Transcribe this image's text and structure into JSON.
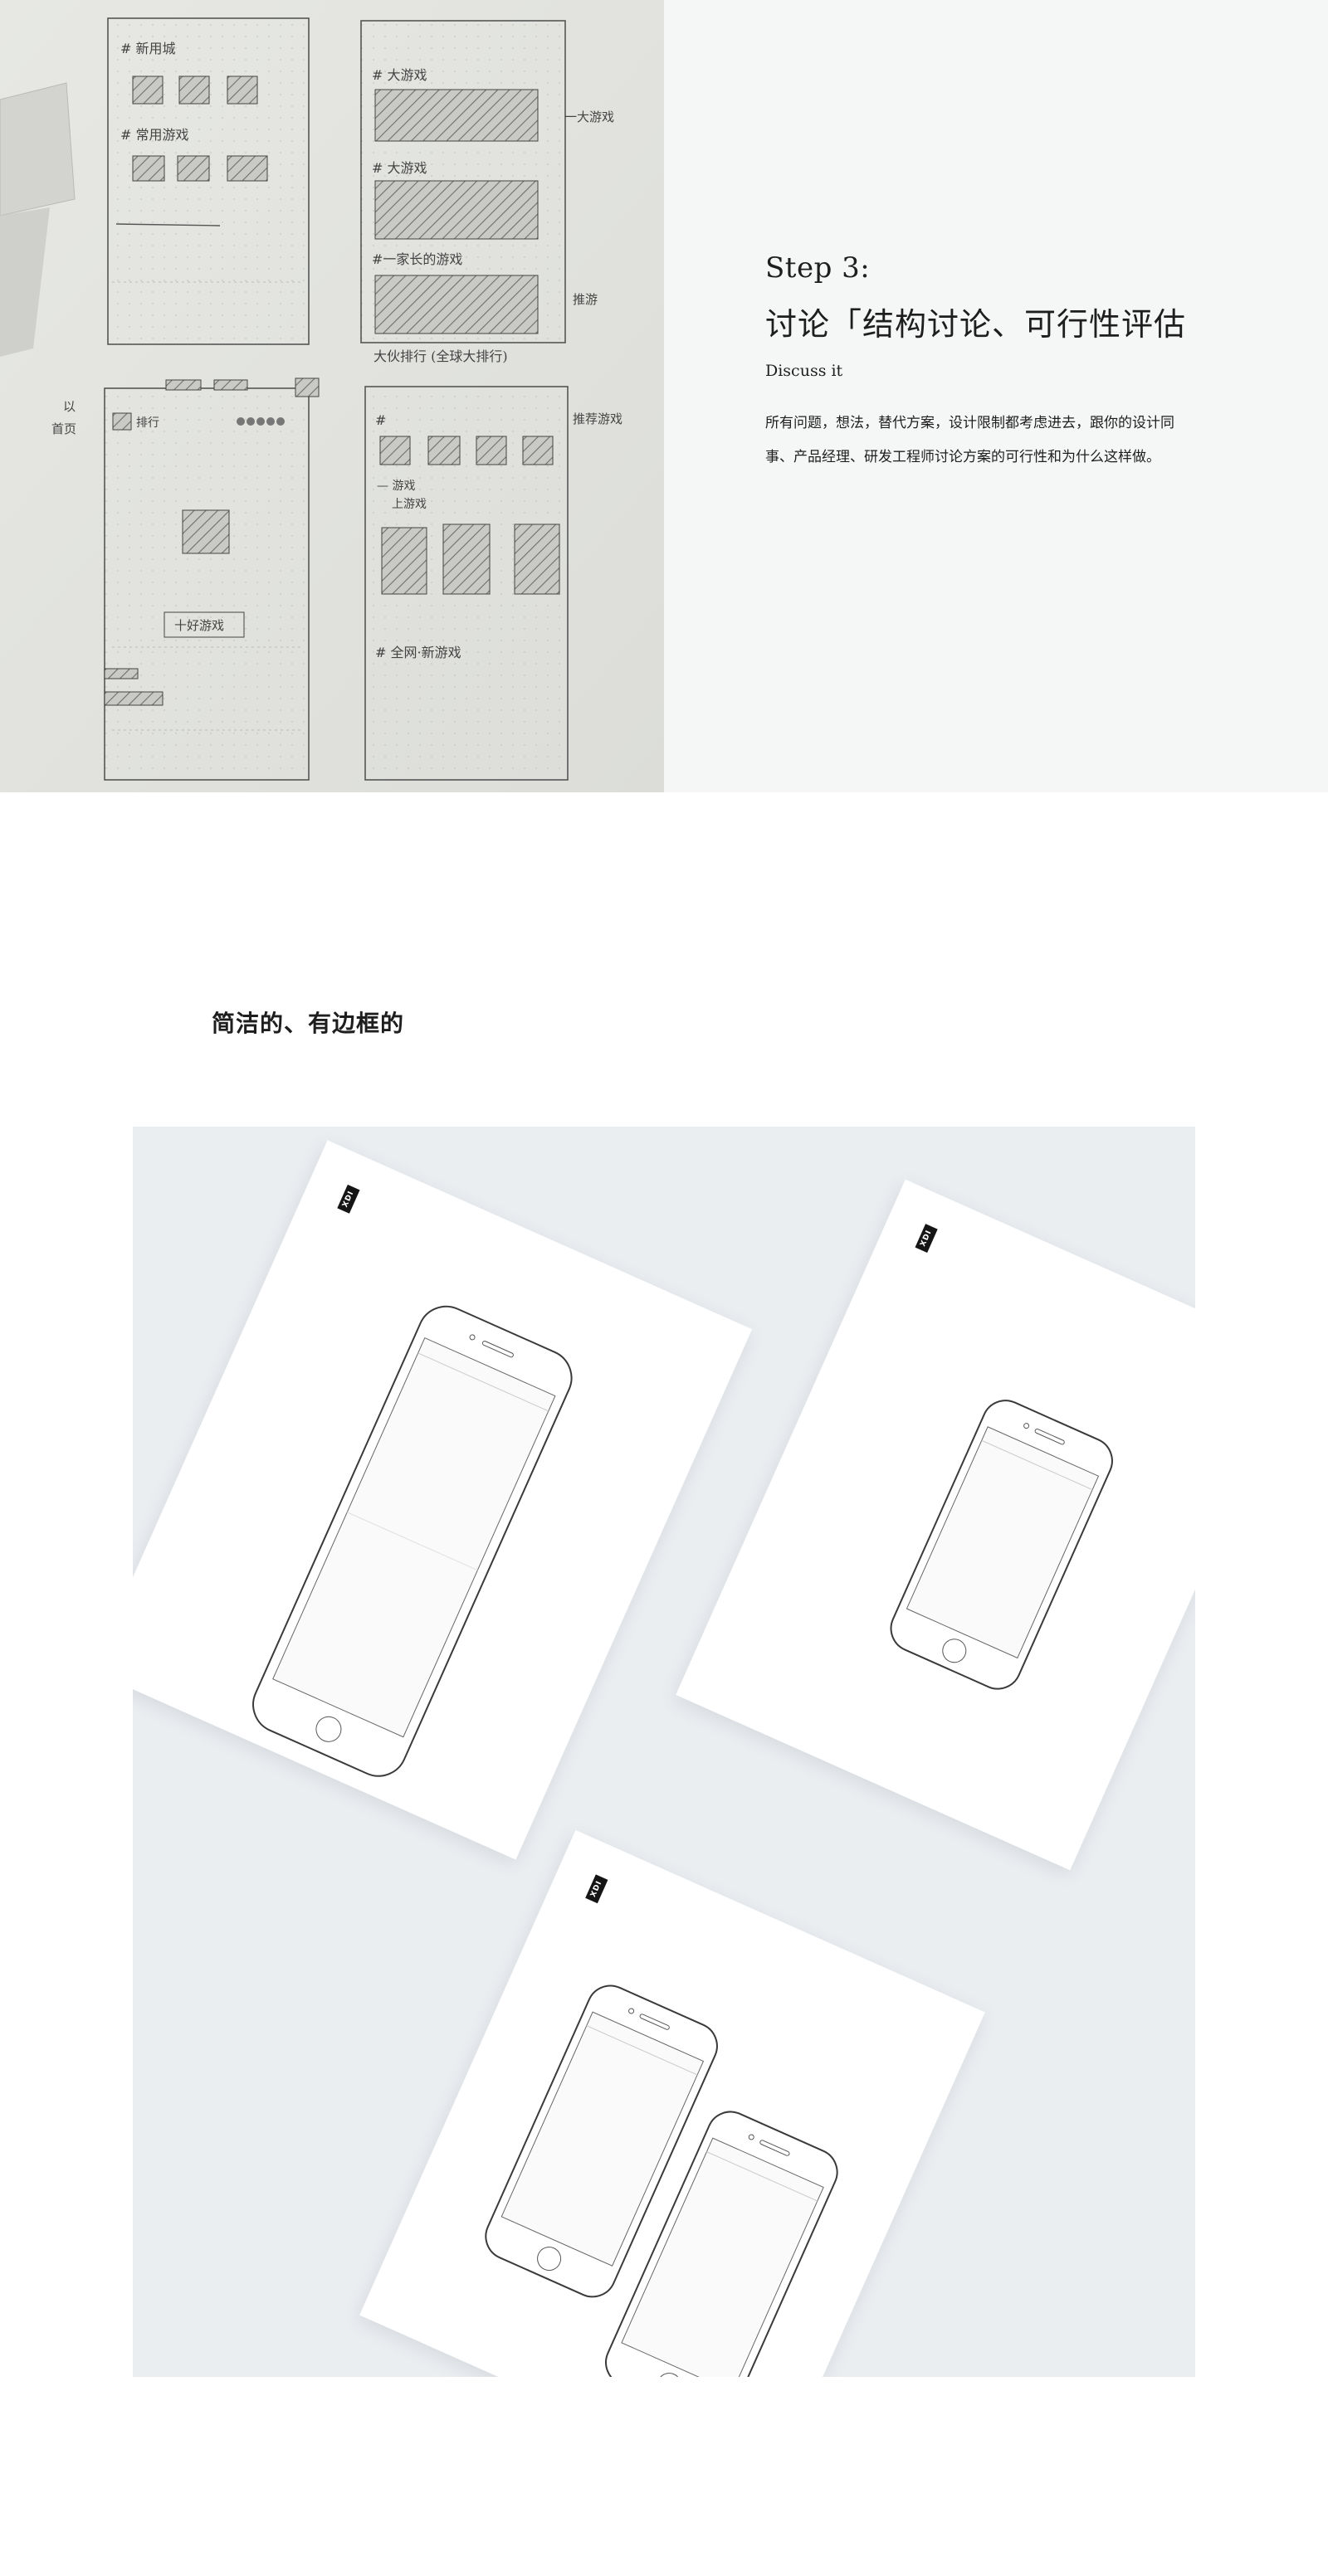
{
  "step": {
    "label": "Step 3:",
    "title": "讨论「结构讨论、可行性评估",
    "subtitle": "Discuss it",
    "description": "所有问题，想法，替代方案，设计限制都考虑进去，跟你的设计同事、产品经理、研发工程师讨论方案的可行性和为什么这样做。"
  },
  "sketch": {
    "notes": [
      "# 新用城",
      "# 常用游戏",
      "# 大游戏",
      "一大游戏",
      "# 大游戏",
      "#一家长的游戏",
      "大伙排行 (全球大排行)",
      "推荐游戏",
      "# 全网·新游戏",
      "— 游戏",
      "上游戏",
      "首页",
      "排行",
      "十好游戏"
    ]
  },
  "templates": {
    "heading": "简洁的、有边框的",
    "brand_label": "XDI"
  },
  "colors": {
    "panel_bg": "#f5f6f6",
    "showcase_bg": "#ebeef1",
    "sheet_bg": "#ffffff",
    "phone_stroke": "#3a3a3a"
  }
}
